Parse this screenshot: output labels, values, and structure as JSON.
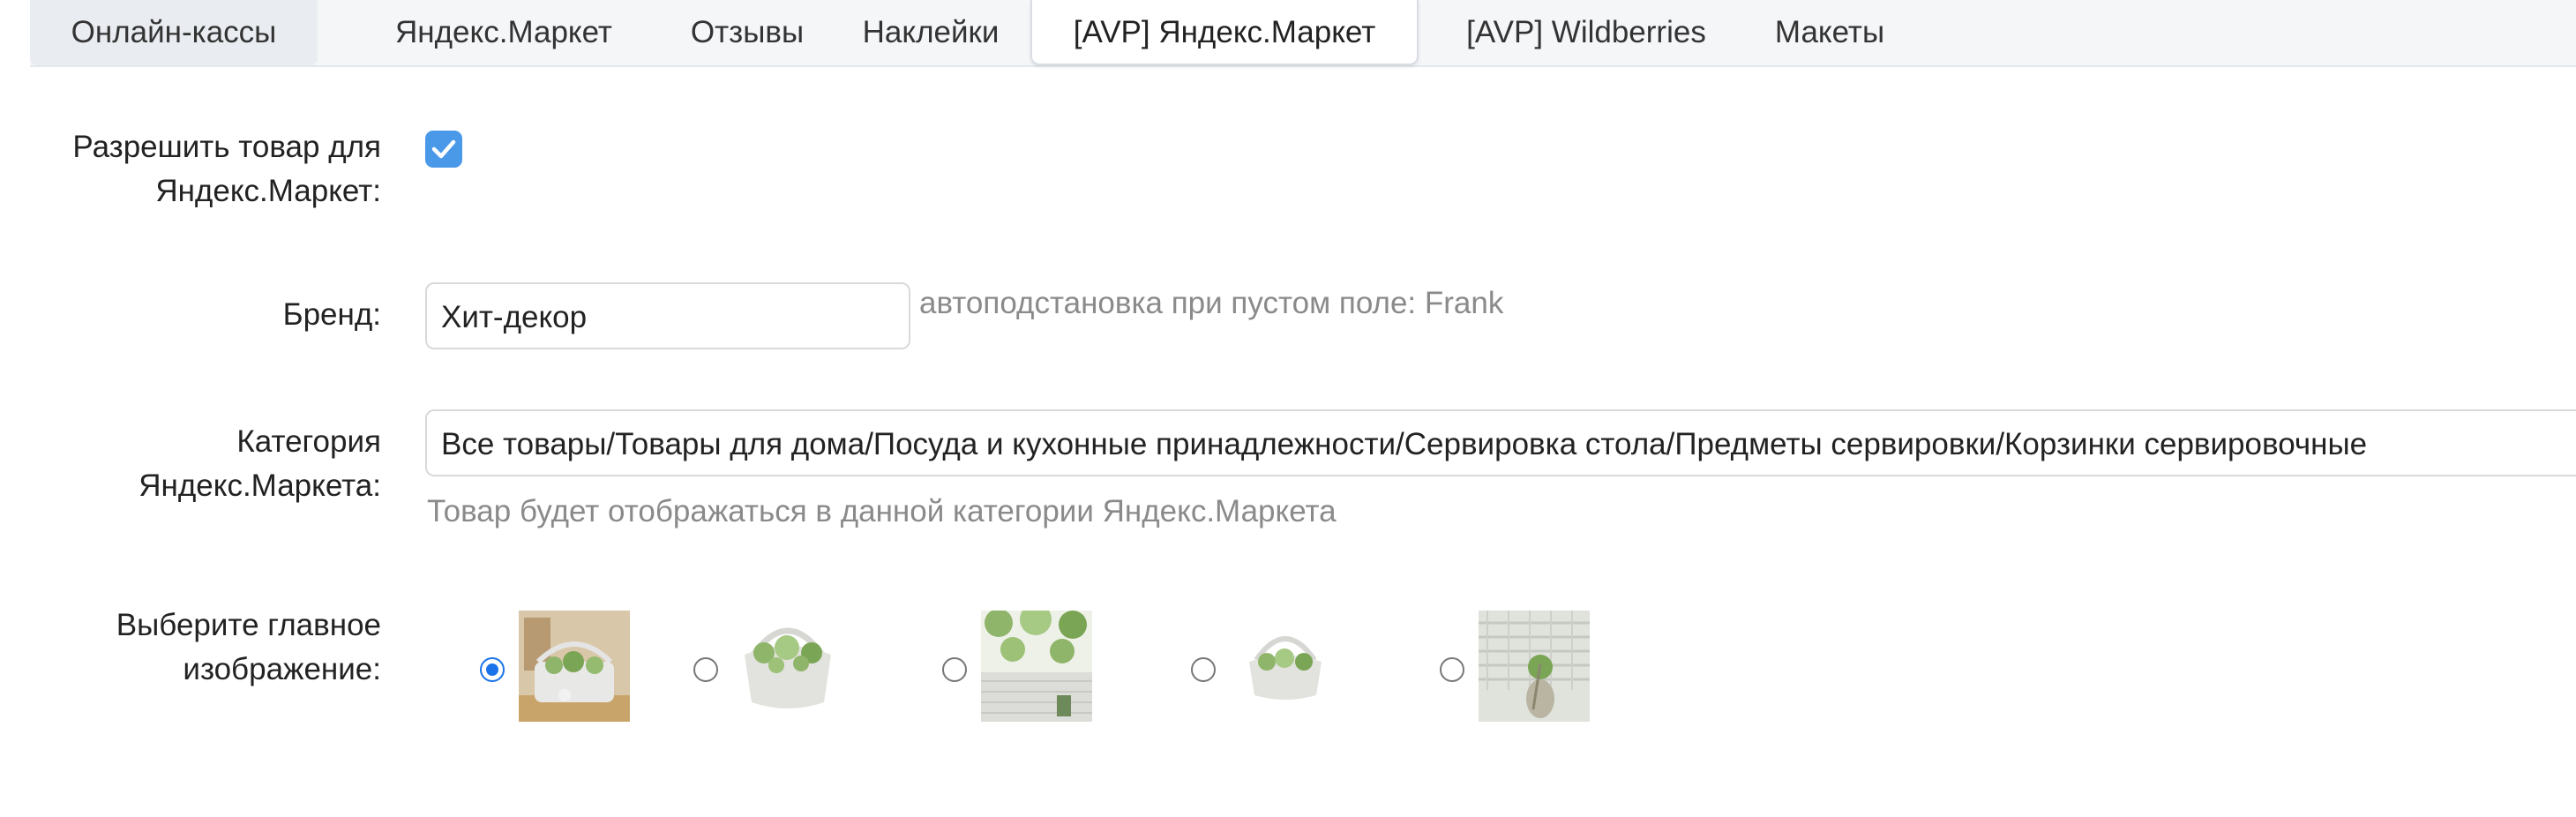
{
  "tabs": [
    {
      "label": "Онлайн-кассы"
    },
    {
      "label": "Яндекс.Маркет"
    },
    {
      "label": "Отзывы"
    },
    {
      "label": "Наклейки"
    },
    {
      "label": "[AVP] Яндекс.Маркет",
      "active": true
    },
    {
      "label": "[AVP] Wildberries"
    },
    {
      "label": "Макеты"
    }
  ],
  "form": {
    "allow_label_line1": "Разрешить товар для",
    "allow_label_line2": "Яндекс.Маркет:",
    "allow_checked": true,
    "brand_label": "Бренд:",
    "brand_value": "Хит-декор",
    "brand_hint": "автоподстановка при пустом поле: Frank",
    "category_label_line1": "Категория",
    "category_label_line2": "Яндекс.Маркета:",
    "category_value": "Все товары/Товары для дома/Посуда и кухонные принадлежности/Сервировка стола/Предметы сервировки/Корзинки сервировочные",
    "category_hint": "Товар будет отображаться в данной категории Яндекс.Маркета",
    "main_image_label_line1": "Выберите главное",
    "main_image_label_line2": "изображение:",
    "selected_image_index": 0
  },
  "images": [
    {
      "name": "basket-photo-1"
    },
    {
      "name": "basket-photo-2"
    },
    {
      "name": "basket-photo-3"
    },
    {
      "name": "basket-photo-4"
    },
    {
      "name": "basket-photo-5"
    }
  ],
  "colors": {
    "accent": "#1a73e8",
    "checkbox": "#4a98e8",
    "hint": "#8a8a8a"
  }
}
